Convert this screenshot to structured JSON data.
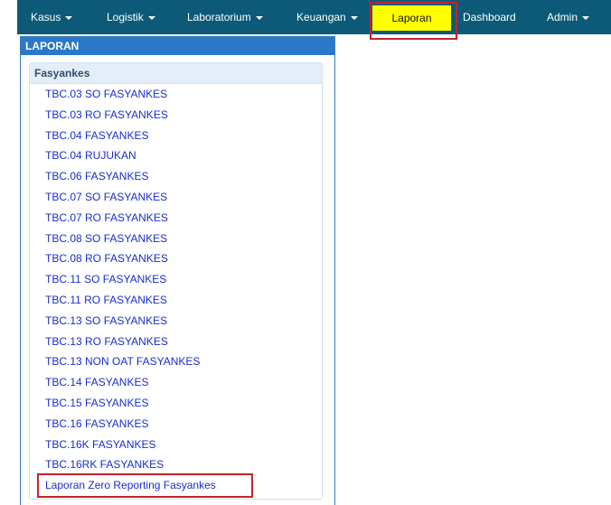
{
  "nav": {
    "items": [
      {
        "label": "Kasus",
        "dropdown": true
      },
      {
        "label": "Logistik",
        "dropdown": true
      },
      {
        "label": "Laboratorium",
        "dropdown": true
      },
      {
        "label": "Keuangan",
        "dropdown": true
      },
      {
        "label": "Laporan",
        "dropdown": false,
        "active": true
      },
      {
        "label": "Dashboard",
        "dropdown": false
      },
      {
        "label": "Admin",
        "dropdown": true
      }
    ]
  },
  "panel": {
    "title": "LAPORAN",
    "section_title": "Fasyankes",
    "links": [
      "TBC.03 SO FASYANKES",
      "TBC.03 RO FASYANKES",
      "TBC.04 FASYANKES",
      "TBC.04 RUJUKAN",
      "TBC.06 FASYANKES",
      "TBC.07 SO FASYANKES",
      "TBC.07 RO FASYANKES",
      "TBC.08 SO FASYANKES",
      "TBC.08 RO FASYANKES",
      "TBC.11 SO FASYANKES",
      "TBC.11 RO FASYANKES",
      "TBC.13 SO FASYANKES",
      "TBC.13 RO FASYANKES",
      "TBC.13 NON OAT FASYANKES",
      "TBC.14 FASYANKES",
      "TBC.15 FASYANKES",
      "TBC.16 FASYANKES",
      "TBC.16K FASYANKES",
      "TBC.16RK FASYANKES",
      "Laporan Zero Reporting Fasyankes"
    ]
  },
  "colors": {
    "navbar": "#0c5a78",
    "active_tab": "#ffff00",
    "highlight": "#c0262b",
    "panel_header": "#2a79c9",
    "link": "#1b2dcc"
  }
}
